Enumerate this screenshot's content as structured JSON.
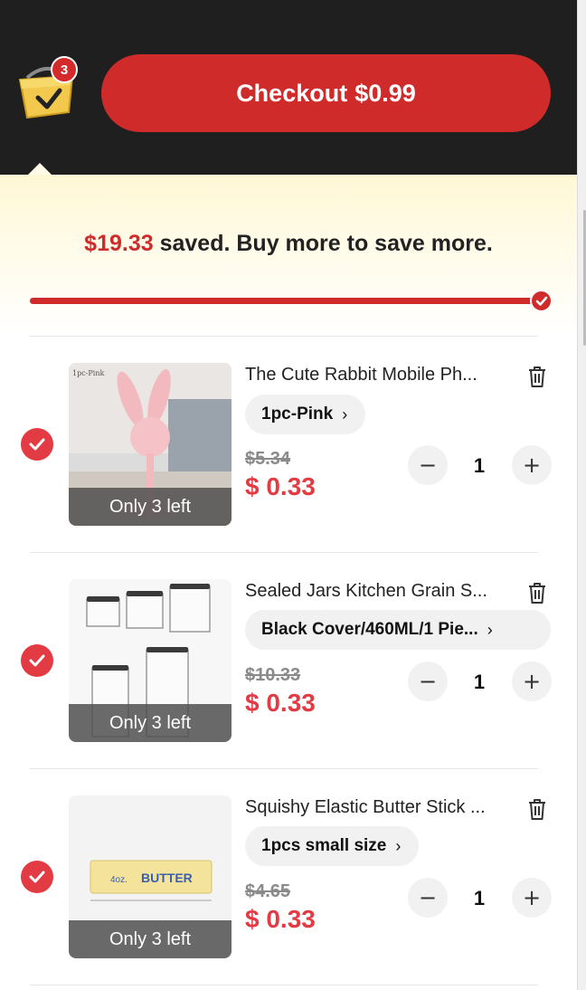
{
  "header": {
    "cart_badge": "3",
    "checkout_label": "Checkout",
    "checkout_total": "$0.99"
  },
  "savings": {
    "amount": "$19.33",
    "message": "saved. Buy more to save more.",
    "progress": 1.0
  },
  "items": [
    {
      "title": "The Cute Rabbit Mobile Ph...",
      "variant": "1pc-Pink",
      "old_price": "$5.34",
      "price": "$ 0.33",
      "quantity": "1",
      "stock": "Only 3 left",
      "image_caption": "1pc-Pink",
      "checked": true
    },
    {
      "title": "Sealed Jars Kitchen Grain S...",
      "variant": "Black Cover/460ML/1 Pie...",
      "old_price": "$10.33",
      "price": "$ 0.33",
      "quantity": "1",
      "stock": "Only 3 left",
      "checked": true
    },
    {
      "title": "Squishy Elastic Butter Stick ...",
      "variant": "1pcs small size",
      "old_price": "$4.65",
      "price": "$ 0.33",
      "quantity": "1",
      "stock": "Only 3 left",
      "image_label_size": "4oz.",
      "image_label_name": "BUTTER",
      "checked": true
    }
  ],
  "colors": {
    "accent": "#cf2b2b",
    "price": "#e23b44",
    "header_bg": "#1f1f1f"
  },
  "icons": [
    "shopping-basket-icon",
    "checkmark-icon",
    "trash-icon",
    "chevron-right-icon",
    "minus-icon",
    "plus-icon"
  ]
}
